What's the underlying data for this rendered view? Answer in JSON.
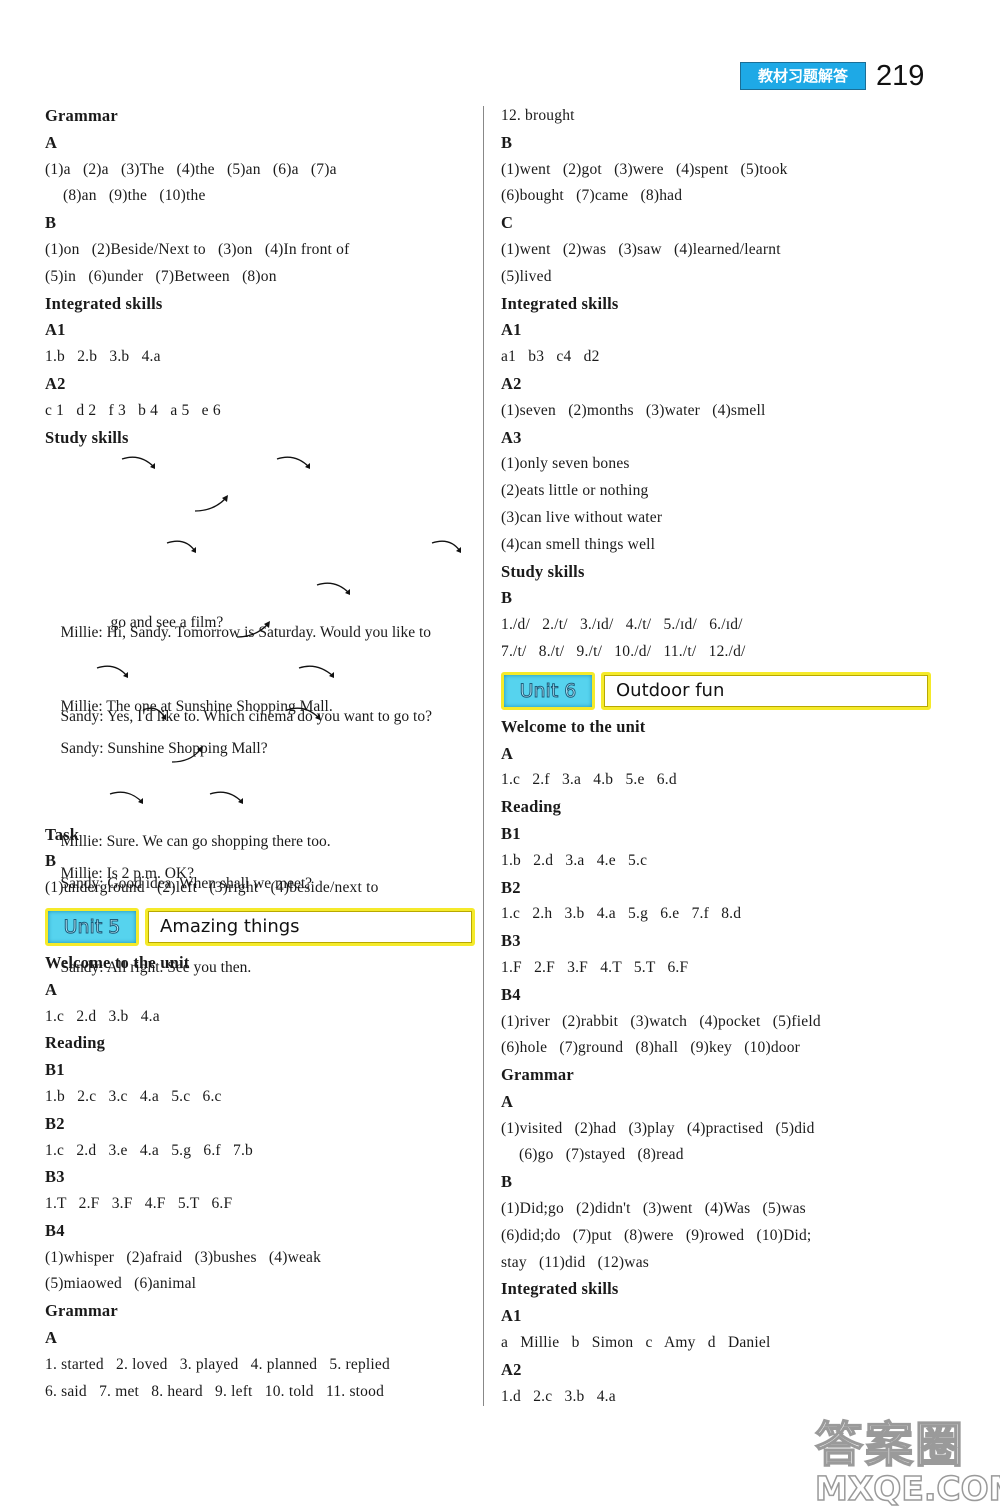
{
  "header": {
    "badge": "教材习题解答",
    "page_number": "219"
  },
  "left": {
    "grammar": {
      "title": "Grammar",
      "A": {
        "label": "A",
        "line1": "(1)a   (2)a   (3)The   (4)the   (5)an   (6)a   (7)a",
        "line2": "(8)an   (9)the   (10)the"
      },
      "B": {
        "label": "B",
        "line1": "(1)on   (2)Beside/Next to   (3)on   (4)In front of",
        "line2": "(5)in   (6)under   (7)Between   (8)on"
      }
    },
    "integrated": {
      "title": "Integrated skills",
      "A1": {
        "label": "A1",
        "line": "1.b   2.b   3.b   4.a"
      },
      "A2": {
        "label": "A2",
        "line": "c 1   d 2   f 3   b 4   a 5   e 6"
      }
    },
    "study": {
      "title": "Study skills",
      "dialogue": [
        "Millie: Hi, Sandy. Tomorrow is Saturday. Would you like to",
        "go and see a film?",
        "Sandy: Yes, I'd like to. Which cinema do you want to go to?",
        "Millie: The one at Sunshine Shopping Mall.",
        "Sandy: Sunshine Shopping Mall?",
        "Millie: Sure. We can go shopping there too.",
        "Sandy: Good idea. When shall we meet?",
        "Millie: Is 2 p.m. OK?",
        "Sandy: All right. See you then."
      ]
    },
    "task": {
      "title": "Task",
      "B": {
        "label": "B",
        "line": "(1)underground   (2)left   (3)right   (4)beside/next to"
      }
    },
    "unit5": {
      "badge": "Unit 5",
      "title": "Amazing things",
      "welcome": {
        "title": "Welcome to the unit",
        "A": {
          "label": "A",
          "line": "1.c   2.d   3.b   4.a"
        }
      },
      "reading": {
        "title": "Reading",
        "B1": {
          "label": "B1",
          "line": "1.b   2.c   3.c   4.a   5.c   6.c"
        },
        "B2": {
          "label": "B2",
          "line": "1.c   2.d   3.e   4.a   5.g   6.f   7.b"
        },
        "B3": {
          "label": "B3",
          "line": "1.T   2.F   3.F   4.F   5.T   6.F"
        },
        "B4": {
          "label": "B4",
          "line1": "(1)whisper   (2)afraid   (3)bushes   (4)weak",
          "line2": "(5)miaowed   (6)animal"
        }
      },
      "grammar": {
        "title": "Grammar",
        "A": {
          "label": "A",
          "line1": "1. started   2. loved   3. played   4. planned   5. replied",
          "line2": "6. said   7. met   8. heard   9. left   10. told   11. stood"
        }
      }
    }
  },
  "right": {
    "cont_line": "12. brought",
    "B": {
      "label": "B",
      "line1": "(1)went   (2)got   (3)were   (4)spent   (5)took",
      "line2": "(6)bought   (7)came   (8)had"
    },
    "C": {
      "label": "C",
      "line1": "(1)went   (2)was   (3)saw   (4)learned/learnt",
      "line2": "(5)lived"
    },
    "integrated": {
      "title": "Integrated skills",
      "A1": {
        "label": "A1",
        "line": "a1   b3   c4   d2"
      },
      "A2": {
        "label": "A2",
        "line": "(1)seven   (2)months   (3)water   (4)smell"
      },
      "A3": {
        "label": "A3",
        "lines": [
          "(1)only seven bones",
          "(2)eats little or nothing",
          "(3)can live without water",
          "(4)can smell things well"
        ]
      }
    },
    "study": {
      "title": "Study skills",
      "B": {
        "label": "B",
        "line1": "1./d/   2./t/   3./ɪd/   4./t/   5./ɪd/   6./ɪd/",
        "line2": "7./t/   8./t/   9./t/   10./d/   11./t/   12./d/"
      }
    },
    "unit6": {
      "badge": "Unit 6",
      "title": "Outdoor fun",
      "welcome": {
        "title": "Welcome to the unit",
        "A": {
          "label": "A",
          "line": "1.c   2.f   3.a   4.b   5.e   6.d"
        }
      },
      "reading": {
        "title": "Reading",
        "B1": {
          "label": "B1",
          "line": "1.b   2.d   3.a   4.e   5.c"
        },
        "B2": {
          "label": "B2",
          "line": "1.c   2.h   3.b   4.a   5.g   6.e   7.f   8.d"
        },
        "B3": {
          "label": "B3",
          "line": "1.F   2.F   3.F   4.T   5.T   6.F"
        },
        "B4": {
          "label": "B4",
          "line1": "(1)river   (2)rabbit   (3)watch   (4)pocket   (5)field",
          "line2": "(6)hole   (7)ground   (8)hall   (9)key   (10)door"
        }
      },
      "grammar": {
        "title": "Grammar",
        "A": {
          "label": "A",
          "line1": "(1)visited   (2)had   (3)play   (4)practised   (5)did",
          "line2": "(6)go   (7)stayed   (8)read"
        },
        "B": {
          "label": "B",
          "line1": "(1)Did;go   (2)didn't   (3)went   (4)Was   (5)was",
          "line2": "(6)did;do   (7)put   (8)were   (9)rowed   (10)Did;",
          "line3": "stay   (11)did   (12)was"
        }
      },
      "integrated": {
        "title": "Integrated skills",
        "A1": {
          "label": "A1",
          "line": "a   Millie   b   Simon   c   Amy   d   Daniel"
        },
        "A2": {
          "label": "A2",
          "line": "1.d   2.c   3.b   4.a"
        }
      }
    }
  },
  "watermark": {
    "line1": "答案圈",
    "line2": "MXQE.COM"
  },
  "colors": {
    "badge_blue": "#1ea9e6",
    "unit_cyan": "#56d3ee",
    "unit_yellow": "#f5ea2a"
  }
}
